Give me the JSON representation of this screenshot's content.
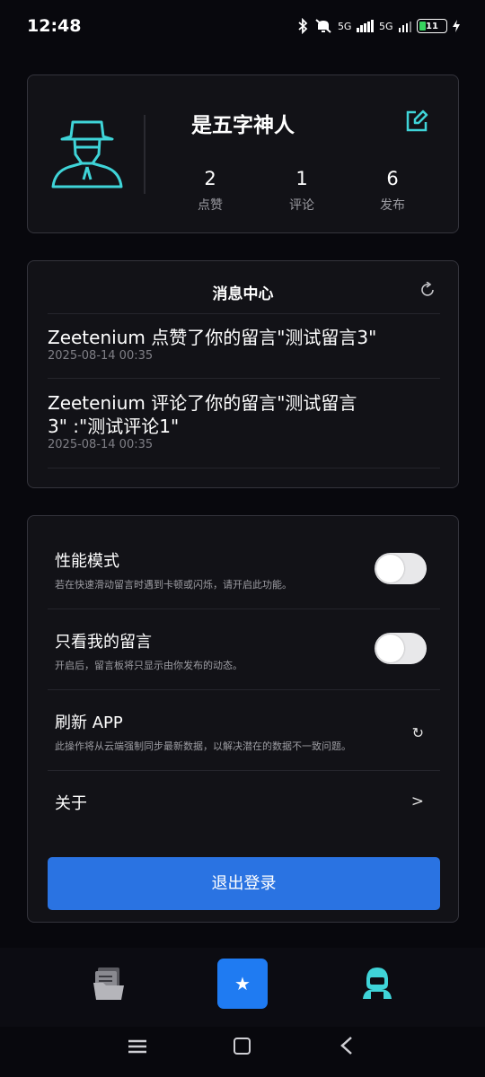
{
  "status_bar": {
    "time": "12:48",
    "network_1": "5G",
    "network_2": "5G",
    "battery": "11"
  },
  "profile": {
    "nickname": "是五字神人",
    "stats": [
      {
        "value": "2",
        "label": "点赞"
      },
      {
        "value": "1",
        "label": "评论"
      },
      {
        "value": "6",
        "label": "发布"
      }
    ],
    "accent_color": "#3fd4d8"
  },
  "messages": {
    "title": "消息中心",
    "items": [
      {
        "text_line1": "Zeetenium 点赞了你的留言\"测试留言3\"",
        "text_line2": "",
        "time": "2025-08-14 00:35"
      },
      {
        "text_line1": "Zeetenium 评论了你的留言\"测试留言",
        "text_line2": "3\" :\"测试评论1\"",
        "time": "2025-08-14 00:35"
      }
    ]
  },
  "settings": {
    "performance_mode": {
      "title": "性能模式",
      "desc": "若在快速滑动留言时遇到卡顿或闪烁，请开启此功能。",
      "enabled": false
    },
    "only_mine": {
      "title": "只看我的留言",
      "desc": "开启后，留言板将只显示由你发布的动态。",
      "enabled": false
    },
    "refresh_app": {
      "title": "刷新 APP",
      "desc": "此操作将从云端强制同步最新数据，以解决潜在的数据不一致问题。",
      "icon": "↻"
    },
    "about": {
      "title": "关于",
      "chevron": ">"
    },
    "logout_label": "退出登录",
    "logout_color": "#2a73e2"
  },
  "bottom_nav": {
    "star_glyph": "★",
    "active_color": "#1f7bf2"
  }
}
